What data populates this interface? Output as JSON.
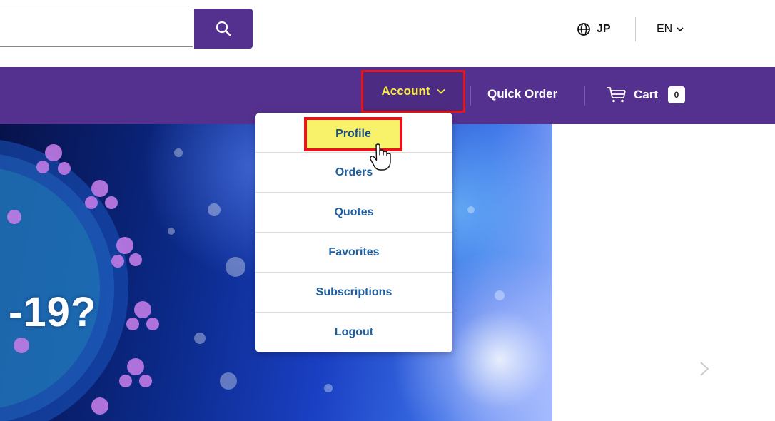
{
  "header": {
    "search": {
      "value": "",
      "placeholder": ""
    },
    "region": "JP",
    "language": "EN"
  },
  "nav": {
    "account": "Account",
    "quick_order": "Quick Order",
    "cart": "Cart",
    "cart_count": "0"
  },
  "account_menu": {
    "items": [
      "Profile",
      "Orders",
      "Quotes",
      "Favorites",
      "Subscriptions",
      "Logout"
    ]
  },
  "hero": {
    "text": "-19?"
  },
  "colors": {
    "brand_purple": "#55318f",
    "account_highlight": "#f7ef3c",
    "annotation_red": "#e4161b",
    "menu_link": "#1f5fa0"
  },
  "icons": [
    "search-icon",
    "globe-icon",
    "chevron-down-icon",
    "cart-icon",
    "chevron-right-icon",
    "hand-cursor-icon"
  ]
}
